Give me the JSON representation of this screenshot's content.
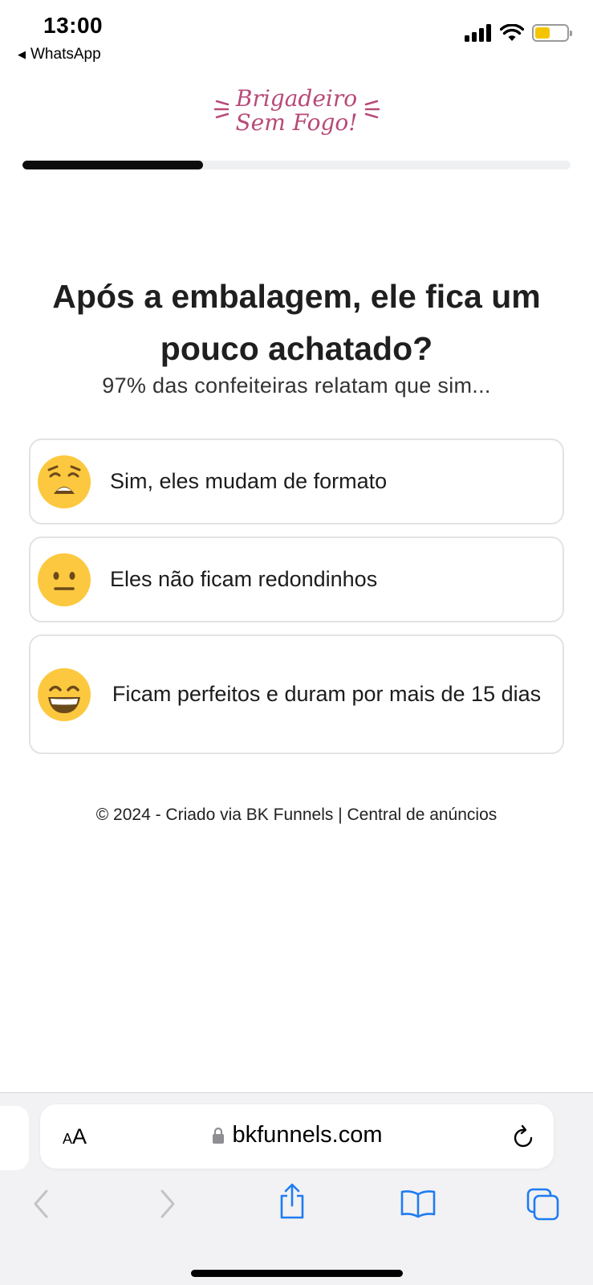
{
  "status_bar": {
    "time": "13:00",
    "back_app": "WhatsApp"
  },
  "logo": {
    "line1": "Brigadeiro",
    "line2": "Sem Fogo!"
  },
  "progress": {
    "fraction": 0.33
  },
  "question": {
    "title": "Após a embalagem, ele fica um pouco achatado?",
    "subtitle": "97% das confeiteiras relatam que sim..."
  },
  "options": [
    {
      "label": "Sim, eles mudam de formato",
      "icon": "weary-face-icon"
    },
    {
      "label": "Eles não ficam redondinhos",
      "icon": "neutral-face-icon"
    },
    {
      "label": "Ficam perfeitos e duram por mais de 15 dias",
      "icon": "grinning-face-icon"
    }
  ],
  "footer": {
    "text": "© 2024 - Criado via BK Funnels | Central de anúncios"
  },
  "browser": {
    "text_size_label": "AA",
    "url": "bkfunnels.com"
  },
  "colors": {
    "brand": "#b84a78",
    "progress": "#0d0d0d",
    "emoji": "#fcc83f",
    "ios_blue": "#1e7cf2"
  }
}
